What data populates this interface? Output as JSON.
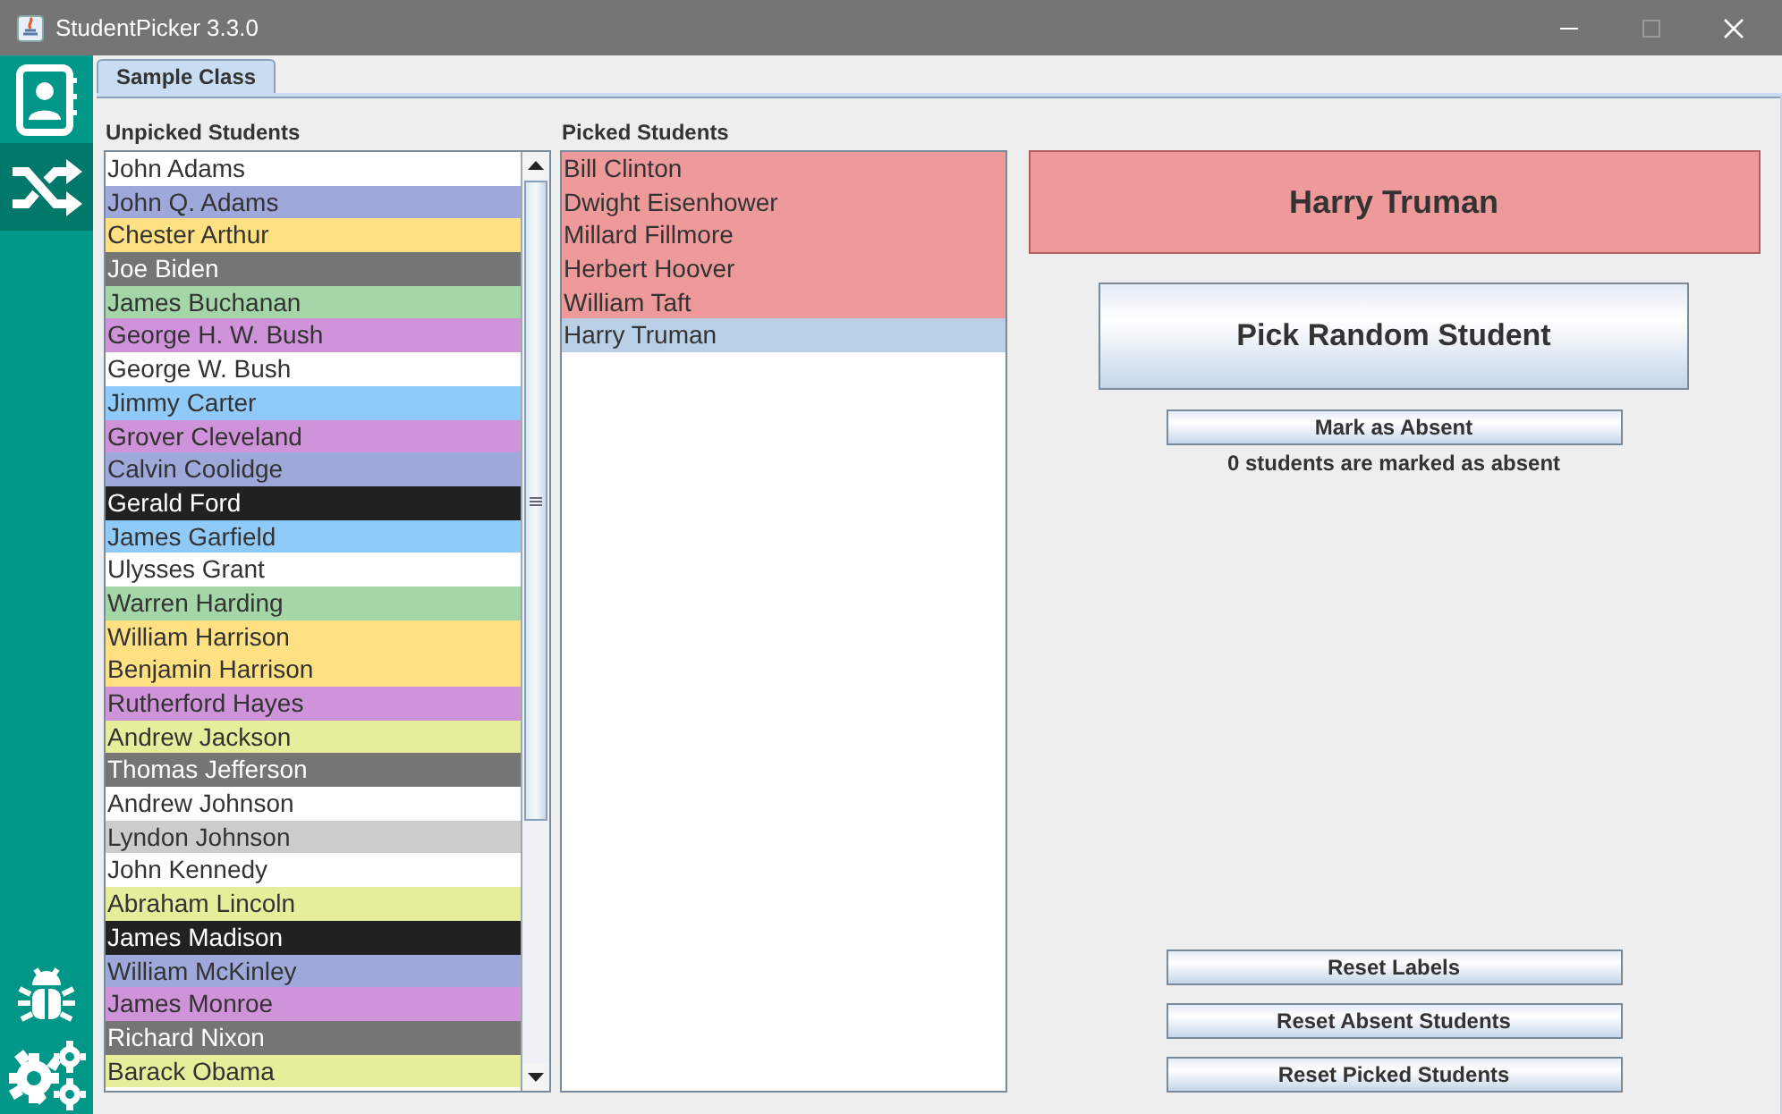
{
  "window": {
    "title": "StudentPicker 3.3.0"
  },
  "sidebar": {
    "items": [
      {
        "kind": "roster",
        "selected": false
      },
      {
        "kind": "shuffle",
        "selected": true
      },
      {
        "kind": "bug",
        "selected": false
      },
      {
        "kind": "settings",
        "selected": false
      }
    ]
  },
  "tabs": [
    {
      "label": "Sample Class",
      "selected": true
    }
  ],
  "unpicked": {
    "title": "Unpicked Students",
    "items": [
      {
        "name": "John Adams",
        "color": "#ffffff"
      },
      {
        "name": "John Q. Adams",
        "color": "#9fa8da"
      },
      {
        "name": "Chester Arthur",
        "color": "#ffe082"
      },
      {
        "name": "Joe Biden",
        "color": "#757575"
      },
      {
        "name": "James Buchanan",
        "color": "#a5d6a7"
      },
      {
        "name": "George H. W. Bush",
        "color": "#ce93d8"
      },
      {
        "name": "George W. Bush",
        "color": "#ffffff"
      },
      {
        "name": "Jimmy Carter",
        "color": "#90caf9"
      },
      {
        "name": "Grover Cleveland",
        "color": "#ce93d8"
      },
      {
        "name": "Calvin Coolidge",
        "color": "#9fa8da"
      },
      {
        "name": "Gerald Ford",
        "color": "#212121"
      },
      {
        "name": "James Garfield",
        "color": "#90caf9"
      },
      {
        "name": "Ulysses Grant",
        "color": "#ffffff"
      },
      {
        "name": "Warren Harding",
        "color": "#a5d6a7"
      },
      {
        "name": "William Harrison",
        "color": "#ffe082"
      },
      {
        "name": "Benjamin Harrison",
        "color": "#ffe082"
      },
      {
        "name": "Rutherford Hayes",
        "color": "#ce93d8"
      },
      {
        "name": "Andrew Jackson",
        "color": "#e6ee9c"
      },
      {
        "name": "Thomas Jefferson",
        "color": "#757575"
      },
      {
        "name": "Andrew Johnson",
        "color": "#ffffff"
      },
      {
        "name": "Lyndon Johnson",
        "color": "#cccccc"
      },
      {
        "name": "John Kennedy",
        "color": "#ffffff"
      },
      {
        "name": "Abraham Lincoln",
        "color": "#e6ee9c"
      },
      {
        "name": "James Madison",
        "color": "#212121"
      },
      {
        "name": "William McKinley",
        "color": "#9fa8da"
      },
      {
        "name": "James Monroe",
        "color": "#ce93d8"
      },
      {
        "name": "Richard Nixon",
        "color": "#757575"
      },
      {
        "name": "Barack Obama",
        "color": "#e6ee9c"
      }
    ]
  },
  "picked": {
    "title": "Picked Students",
    "items": [
      {
        "name": "Bill Clinton",
        "color": "#ef9a9a",
        "selected": false
      },
      {
        "name": "Dwight Eisenhower",
        "color": "#ef9a9a",
        "selected": false
      },
      {
        "name": "Millard Fillmore",
        "color": "#ef9a9a",
        "selected": false
      },
      {
        "name": "Herbert Hoover",
        "color": "#ef9a9a",
        "selected": false
      },
      {
        "name": "William Taft",
        "color": "#ef9a9a",
        "selected": false
      },
      {
        "name": "Harry Truman",
        "selected": true
      }
    ]
  },
  "current_pick": {
    "name": "Harry Truman",
    "color": "#ef9a9a"
  },
  "pick_button": "Pick Random Student",
  "absent_button": "Mark as Absent",
  "absent_status": "0 students are marked as absent",
  "reset_buttons": [
    "Reset Labels",
    "Reset Absent Students",
    "Reset Picked Students"
  ]
}
